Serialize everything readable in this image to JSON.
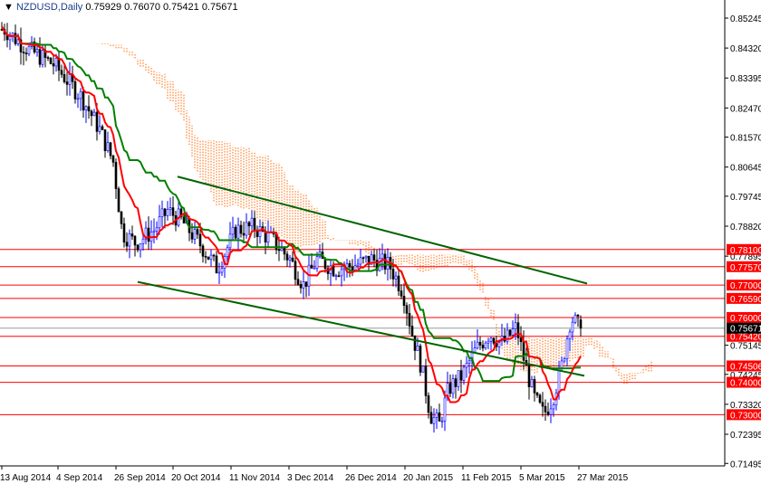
{
  "header": {
    "symbol": "NZDUSD,Daily",
    "ohlc": "0.75929 0.76070 0.75421 0.75671"
  },
  "colors": {
    "bull": "#0000ff",
    "bear": "#000000",
    "tenkan": "#ff0000",
    "kijun": "#008000",
    "cloud": "#ff6600",
    "level": "#ff0000",
    "trend": "#006400"
  },
  "chart_data": {
    "type": "candlestick",
    "title": "NZDUSD,Daily",
    "ylim": [
      0.71,
      0.856
    ],
    "y_ticks": [
      "0.85245",
      "0.84320",
      "0.83395",
      "0.82470",
      "0.81570",
      "0.80645",
      "0.79745",
      "0.78820",
      "0.77895",
      "0.75145",
      "0.74245",
      "0.73320",
      "0.72395",
      "0.71495"
    ],
    "x_ticks": [
      "13 Aug 2014",
      "4 Sep 2014",
      "26 Sep 2014",
      "20 Oct 2014",
      "11 Nov 2014",
      "3 Dec 2014",
      "26 Dec 2014",
      "20 Jan 2015",
      "11 Feb 2015",
      "5 Mar 2015",
      "27 Mar 2015"
    ],
    "close_anchors": [
      0.849,
      0.843,
      0.838,
      0.828,
      0.818,
      0.808,
      0.786,
      0.783,
      0.787,
      0.793,
      0.79,
      0.783,
      0.775,
      0.787,
      0.788,
      0.784,
      0.778,
      0.77,
      0.778,
      0.775,
      0.776,
      0.778,
      0.776,
      0.768,
      0.755,
      0.745,
      0.73,
      0.727,
      0.738,
      0.742,
      0.75,
      0.755,
      0.752,
      0.757,
      0.745,
      0.735,
      0.73,
      0.735,
      0.745,
      0.76,
      0.757
    ],
    "levels": [
      "0.78100",
      "0.77570",
      "0.77000",
      "0.76590",
      "0.76000",
      "0.75420",
      "0.74506",
      "0.74000",
      "0.73000"
    ],
    "current_price": "0.75671",
    "trendlines": [
      {
        "name": "upper-channel",
        "from": [
          "20 Oct 2014",
          0.8035
        ],
        "to": [
          "27 Mar 2015",
          0.7705
        ]
      },
      {
        "name": "lower-channel",
        "from": [
          "26 Sep 2014",
          0.771
        ],
        "to": [
          "27 Mar 2015",
          0.742
        ]
      }
    ],
    "indicators": [
      "Ichimoku Tenkan (red)",
      "Ichimoku Kijun (green)",
      "Ichimoku Cloud (orange)"
    ]
  }
}
